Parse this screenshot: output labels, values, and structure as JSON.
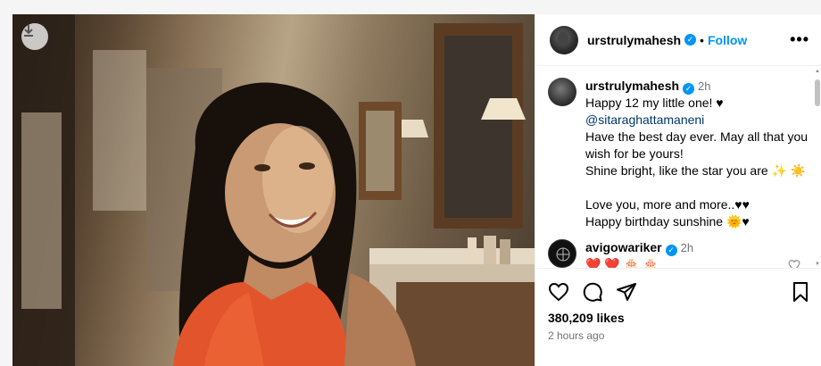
{
  "post": {
    "author": "urstrulymahesh",
    "follow_label": "Follow",
    "separator": "•",
    "more_icon": "•••"
  },
  "caption": {
    "author": "urstrulymahesh",
    "time": "2h",
    "lines": [
      "Happy 12 my little one! ♥",
      "@sitaraghattamaneni",
      "Have the best day ever. May all that you wish for be yours!",
      "Shine bright, like the star you are ✨ ☀️",
      "",
      "Love you, more and more..♥♥",
      "Happy birthday sunshine 🌞♥"
    ]
  },
  "comments": [
    {
      "author": "avigowariker",
      "time": "2h",
      "text": "❤️ ❤️ 🎂 🎂"
    }
  ],
  "stats": {
    "likes": "380,209 likes",
    "ago": "2 hours ago"
  },
  "icons": {
    "download": "download-icon",
    "like": "heart-icon",
    "comment": "comment-icon",
    "share": "share-icon",
    "save": "bookmark-icon"
  },
  "colors": {
    "accent": "#0095f6",
    "mention": "#00376b",
    "muted": "#737373"
  }
}
